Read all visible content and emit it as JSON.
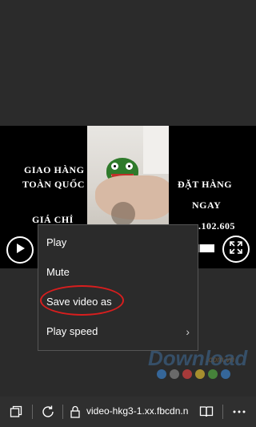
{
  "video": {
    "left_text_line1": "GIAO HÀNG",
    "left_text_line2": "TOÀN QUỐC",
    "left_text_line3": "GIÁ CHỈ",
    "right_text_line1": "ĐẶT HÀNG",
    "right_text_line2": "NGAY",
    "right_text_line3": ".102.605"
  },
  "context_menu": {
    "items": [
      {
        "label": "Play"
      },
      {
        "label": "Mute"
      },
      {
        "label": "Save video as"
      },
      {
        "label": "Play speed"
      }
    ],
    "highlight_color": "#d81e1e"
  },
  "watermark": {
    "text": "Download",
    "suffix": ".com.vn",
    "dot_colors": [
      "#3a7bbf",
      "#808080",
      "#d04040",
      "#d0b030",
      "#50a040",
      "#3a7bbf"
    ]
  },
  "address_bar": {
    "url": "video-hkg3-1.xx.fbcdn.n",
    "icons": [
      "tabs-icon",
      "refresh-icon",
      "lock-icon",
      "reading-view-icon",
      "more-icon"
    ]
  }
}
